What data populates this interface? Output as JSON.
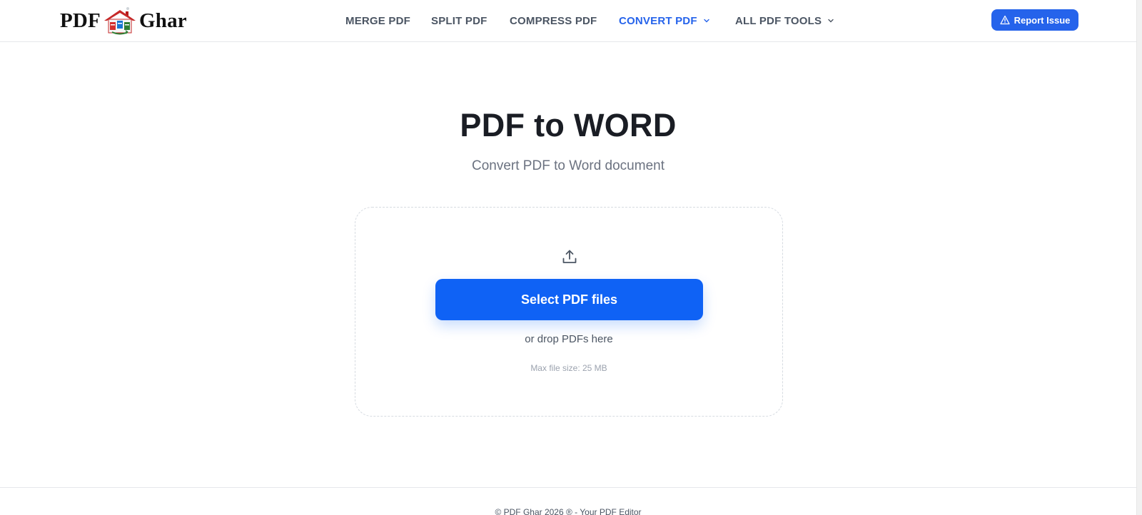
{
  "brand": {
    "logo_left": "PDF",
    "logo_right": "Ghar",
    "logo_icon": "house-logo-icon"
  },
  "nav": {
    "items": [
      {
        "label": "MERGE PDF",
        "active": false,
        "dropdown": false
      },
      {
        "label": "SPLIT PDF",
        "active": false,
        "dropdown": false
      },
      {
        "label": "COMPRESS PDF",
        "active": false,
        "dropdown": false
      },
      {
        "label": "CONVERT PDF",
        "active": true,
        "dropdown": true
      },
      {
        "label": "ALL PDF TOOLS",
        "active": false,
        "dropdown": true
      }
    ],
    "report_label": "Report Issue",
    "report_icon": "warning-triangle-icon"
  },
  "main": {
    "title": "PDF to WORD",
    "subtitle": "Convert PDF to Word document",
    "upload_icon": "upload-icon",
    "select_button": "Select PDF files",
    "drop_text": "or drop PDFs here",
    "max_size": "Max file size: 25 MB"
  },
  "footer": {
    "text": "© PDF Ghar 2026 ® - Your PDF Editor"
  },
  "colors": {
    "accent": "#2563eb",
    "primary_button": "#0f62f5",
    "heading": "#1a1d24",
    "muted": "#6b7280"
  }
}
